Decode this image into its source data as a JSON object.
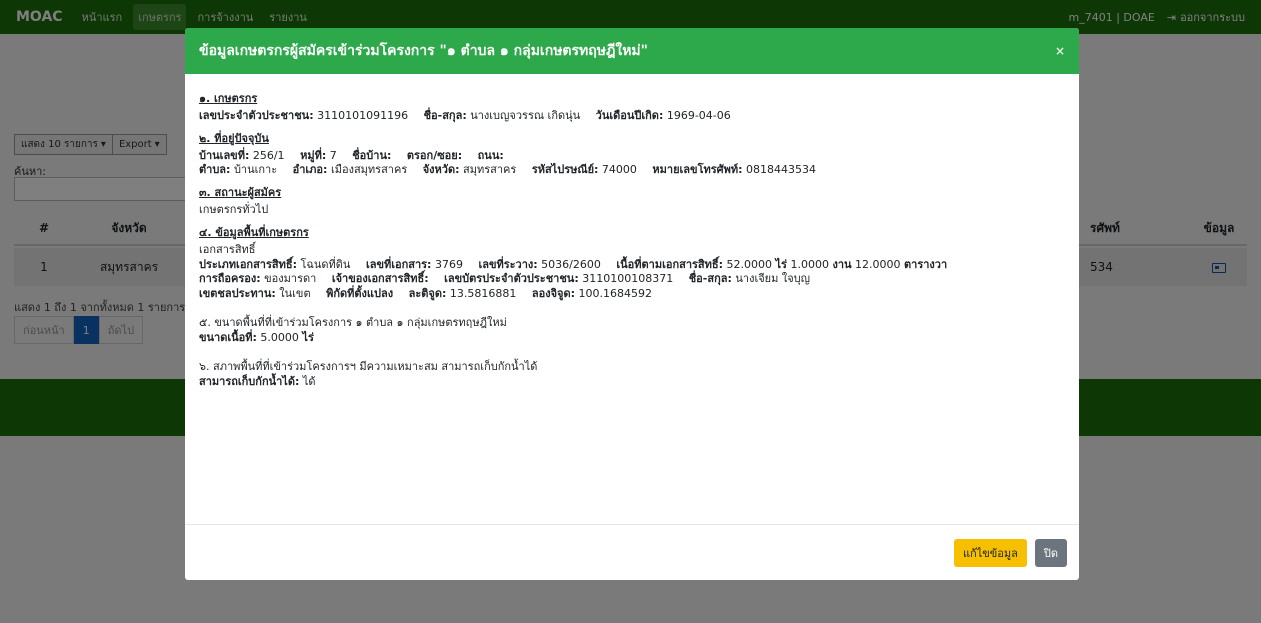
{
  "navbar": {
    "brand": "MOAC",
    "links": [
      "หน้าแรก",
      "เกษตรกร",
      "การจ้างงาน",
      "รายงาน"
    ],
    "user": "m_7401 | DOAE",
    "logout": "ออกจากระบบ"
  },
  "page": {
    "show_entries": "แสดง 10 รายการ",
    "export": "Export",
    "search_label": "ค้นหา:",
    "columns": {
      "num": "#",
      "province": "จังหวัด",
      "phone": "รศัพท์",
      "info": "ข้อมูล"
    },
    "row": {
      "num": "1",
      "province": "สมุทรสาคร",
      "phone": "534"
    },
    "summary": "แสดง 1 ถึง 1 จากทั้งหมด 1 รายการ",
    "prev": "ก่อนหน้า",
    "page": "1",
    "next": "ถัดไป"
  },
  "modal": {
    "title": "ข้อมูลเกษตรกรผู้สมัครเข้าร่วมโครงการ \"๑ ตำบล ๑ กลุ่มเกษตรทฤษฎีใหม่\"",
    "close": "×",
    "s1": {
      "title": "๑. เกษตรกร",
      "id_label": "เลขประจำตัวประชาชน:",
      "id": "3110101091196",
      "name_label": "ชื่อ-สกุล:",
      "name": "นางเบญจวรรณ เกิดนุ่น",
      "dob_label": "วันเดือนปีเกิด:",
      "dob": "1969-04-06"
    },
    "s2": {
      "title": "๒. ที่อยู่ปัจจุบัน",
      "house_label": "บ้านเลขที่:",
      "house": "256/1",
      "moo_label": "หมู่ที่:",
      "moo": "7",
      "village_label": "ชื่อบ้าน:",
      "village": "",
      "alley_label": "ตรอก/ซอย:",
      "alley": "",
      "road_label": "ถนน:",
      "road": "",
      "tambon_label": "ตำบล:",
      "tambon": "บ้านเกาะ",
      "amphoe_label": "อำเภอ:",
      "amphoe": "เมืองสมุทรสาคร",
      "province_label": "จังหวัด:",
      "province": "สมุทรสาคร",
      "zip_label": "รหัสไปรษณีย์:",
      "zip": "74000",
      "phone_label": "หมายเลขโทรศัพท์:",
      "phone": "0818443534"
    },
    "s3": {
      "title": "๓. สถานะผู้สมัคร",
      "status": "เกษตรกรทั่วไป"
    },
    "s4": {
      "title": "๔. ข้อมูลพื้นที่เกษตรกร",
      "ownership": "เอกสารสิทธิ์",
      "doc_type_label": "ประเภทเอกสารสิทธิ์:",
      "doc_type": "โฉนดที่ดิน",
      "doc_no_label": "เลขที่เอกสาร:",
      "doc_no": "3769",
      "survey_label": "เลขที่ระวาง:",
      "survey": "5036/2600",
      "area_label": "เนื้อที่ตามเอกสารสิทธิ์:",
      "area_rai": "52.0000",
      "rai": "ไร่",
      "area_ngan": "1.0000",
      "ngan": "งาน",
      "area_wa": "12.0000",
      "wa": "ตารางวา",
      "holding_label": "การถือครอง:",
      "holding": "ของมารดา",
      "owner_label": "เจ้าของเอกสารสิทธิ์:",
      "owner": "",
      "owner_id_label": "เลขบัตรประจำตัวประชาชน:",
      "owner_id": "3110100108371",
      "owner_name_label": "ชื่อ-สกุล:",
      "owner_name": "นางเจียม ใจบุญ",
      "irrigation_label": "เขตชลประทาน:",
      "irrigation": "ในเขต",
      "coord_label": "พิกัดที่ตั้งแปลง",
      "lat_label": "ละติจูด:",
      "lat": "13.5816881",
      "lng_label": "ลองจิจูด:",
      "lng": "100.1684592"
    },
    "s5": {
      "title": "๕. ขนาดพื้นที่ที่เข้าร่วมโครงการ ๑ ตำบล ๑ กลุ่มเกษตรทฤษฎีใหม่",
      "size_label": "ขนาดเนื้อที่:",
      "size": "5.0000",
      "rai": "ไร่"
    },
    "s6": {
      "title": "๖. สภาพพื้นที่ที่เข้าร่วมโครงการฯ มีความเหมาะสม สามารถเก็บกักน้ำได้",
      "label": "สามารถเก็บกักน้ำได้:",
      "value": "ได้"
    },
    "edit_button": "แก้ไขข้อมูล",
    "close_button": "ปิด"
  }
}
